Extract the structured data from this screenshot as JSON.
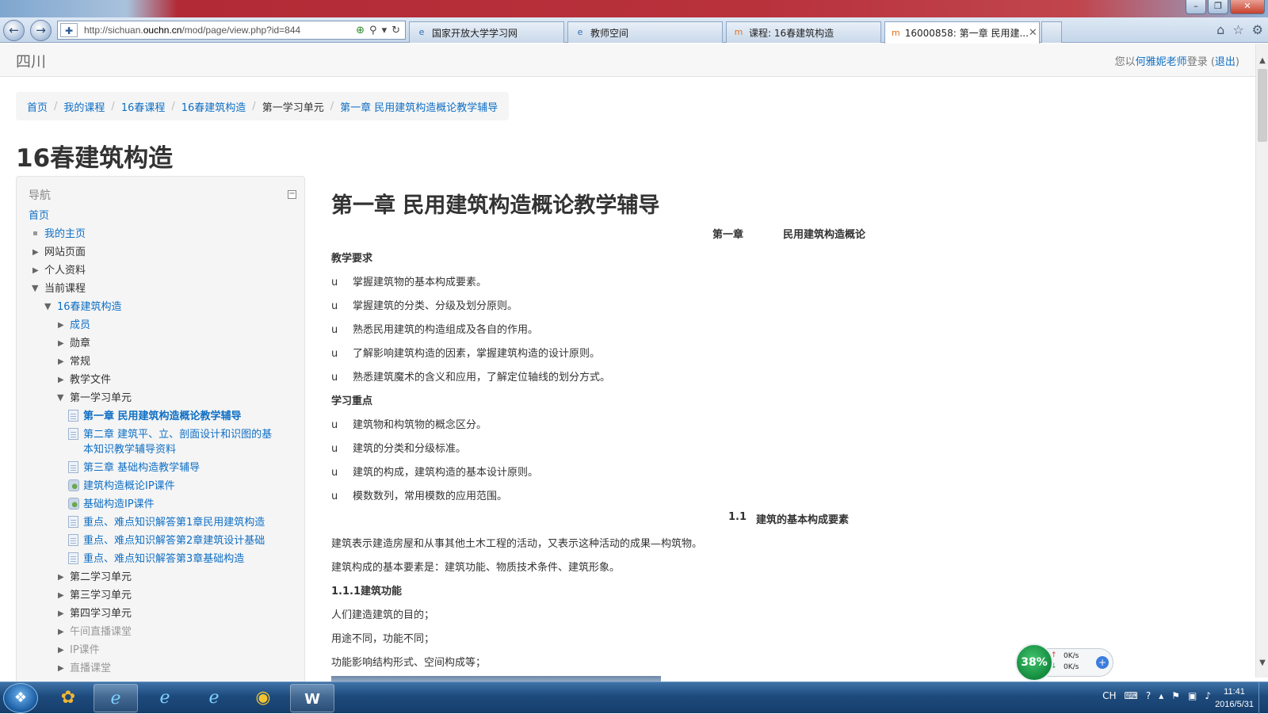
{
  "browser": {
    "url_prefix": "http://sichuan.",
    "url_domain": "ouchn.cn",
    "url_suffix": "/mod/page/view.php?id=844",
    "tabs": [
      {
        "label": "国家开放大学学习网"
      },
      {
        "label": "教师空间"
      },
      {
        "label": "课程: 16春建筑构造"
      },
      {
        "label": "16000858: 第一章 民用建..."
      }
    ],
    "window_buttons": {
      "minimize": "–",
      "restore": "❐",
      "close": "✕"
    }
  },
  "site": {
    "name": "四川",
    "login_prefix": "您以",
    "login_user": "何雅妮老师",
    "login_mid": "登录 (",
    "logout": "退出",
    "login_suffix": ")"
  },
  "breadcrumb": [
    {
      "label": "首页",
      "link": true
    },
    {
      "label": "我的课程",
      "link": true
    },
    {
      "label": "16春课程",
      "link": true
    },
    {
      "label": "16春建筑构造",
      "link": true
    },
    {
      "label": "第一学习单元",
      "link": false
    },
    {
      "label": "第一章 民用建筑构造概论教学辅导",
      "link": true
    }
  ],
  "course_title": "16春建筑构造",
  "nav": {
    "title": "导航",
    "items": [
      {
        "label": "首页"
      },
      {
        "label": "我的主页"
      },
      {
        "label": "网站页面"
      },
      {
        "label": "个人资料"
      },
      {
        "label": "当前课程"
      },
      {
        "label": "16春建筑构造"
      },
      {
        "label": "成员"
      },
      {
        "label": "勋章"
      },
      {
        "label": "常规"
      },
      {
        "label": "教学文件"
      },
      {
        "label": "第一学习单元"
      },
      {
        "label": "第一章 民用建筑构造概论教学辅导"
      },
      {
        "label": "第二章 建筑平、立、剖面设计和识图的基"
      },
      {
        "label": "本知识教学辅导资料"
      },
      {
        "label": "第三章 基础构造教学辅导"
      },
      {
        "label": "建筑构造概论IP课件"
      },
      {
        "label": "基础构造IP课件"
      },
      {
        "label": "重点、难点知识解答第1章民用建筑构造"
      },
      {
        "label": "重点、难点知识解答第2章建筑设计基础"
      },
      {
        "label": "重点、难点知识解答第3章基础构造"
      },
      {
        "label": "第二学习单元"
      },
      {
        "label": "第三学习单元"
      },
      {
        "label": "第四学习单元"
      },
      {
        "label": "午间直播课堂"
      },
      {
        "label": "IP课件"
      },
      {
        "label": "直播课堂"
      }
    ]
  },
  "content": {
    "heading": "第一章 民用建筑构造概论教学辅导",
    "chapter_no": "第一章",
    "chapter_name": "民用建筑构造概论",
    "req_title": "教学要求",
    "bullet_mark": "u",
    "requirements": [
      "掌握建筑物的基本构成要素。",
      "掌握建筑的分类、分级及划分原则。",
      "熟悉民用建筑的构造组成及各自的作用。",
      "了解影响建筑构造的因素，掌握建筑构造的设计原则。",
      "熟悉建筑魔术的含义和应用，了解定位轴线的划分方式。"
    ],
    "focus_title": "学习重点",
    "focus": [
      "建筑物和构筑物的概念区分。",
      "建筑的分类和分级标准。",
      "建筑的构成，建筑构造的基本设计原则。",
      "模数数列，常用模数的应用范围。"
    ],
    "section_no": "1.1",
    "section_name": "建筑的基本构成要素",
    "para1": "建筑表示建造房屋和从事其他土木工程的活动，又表示这种活动的成果—构筑物。",
    "para2": "建筑构成的基本要素是：建筑功能、物质技术条件、建筑形象。",
    "sub_title": "1.1.1建筑功能",
    "lines": [
      "人们建造建筑的目的；",
      "用途不同，功能不同；",
      "功能影响结构形式、空间构成等；"
    ]
  },
  "netmon": {
    "percent": "38%",
    "up": "0K/s",
    "down": "0K/s"
  },
  "taskbar": {
    "tray_lang": "CH",
    "time": "11:41",
    "date": "2016/5/31"
  }
}
